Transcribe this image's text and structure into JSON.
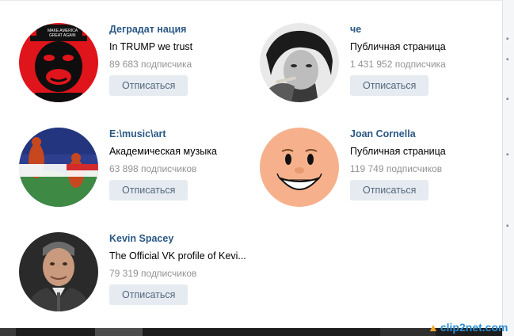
{
  "communities": [
    {
      "title": "Деградат нация",
      "description": "In TRUMP we trust",
      "subscribers": "89 683 подписчика",
      "unsubscribe_label": "Отписаться",
      "avatar_icon": "monkey-che-avatar-icon"
    },
    {
      "title": "че",
      "description": "Публичная страница",
      "subscribers": "1 431 952 подписчика",
      "unsubscribe_label": "Отписаться",
      "avatar_icon": "che-guevara-photo-avatar-icon"
    },
    {
      "title": "E:\\music\\art",
      "description": "Академическая музыка",
      "subscribers": "63 898 подписчиков",
      "unsubscribe_label": "Отписаться",
      "avatar_icon": "painting-avatar-icon"
    },
    {
      "title": "Joan Cornella",
      "description": "Публичная страница",
      "subscribers": "119 749 подписчиков",
      "unsubscribe_label": "Отписаться",
      "avatar_icon": "cartoon-face-avatar-icon"
    },
    {
      "title": "Kevin Spacey",
      "description": "The Official VK profile of Kevi...",
      "subscribers": "79 319 подписчиков",
      "unsubscribe_label": "Отписаться",
      "avatar_icon": "kevin-spacey-photo-avatar-icon"
    }
  ],
  "watermark": {
    "text": "clip2net.com"
  },
  "colors": {
    "link": "#2a5885",
    "muted": "#939393",
    "button_bg": "#e5ebf1",
    "button_text": "#55677d"
  }
}
